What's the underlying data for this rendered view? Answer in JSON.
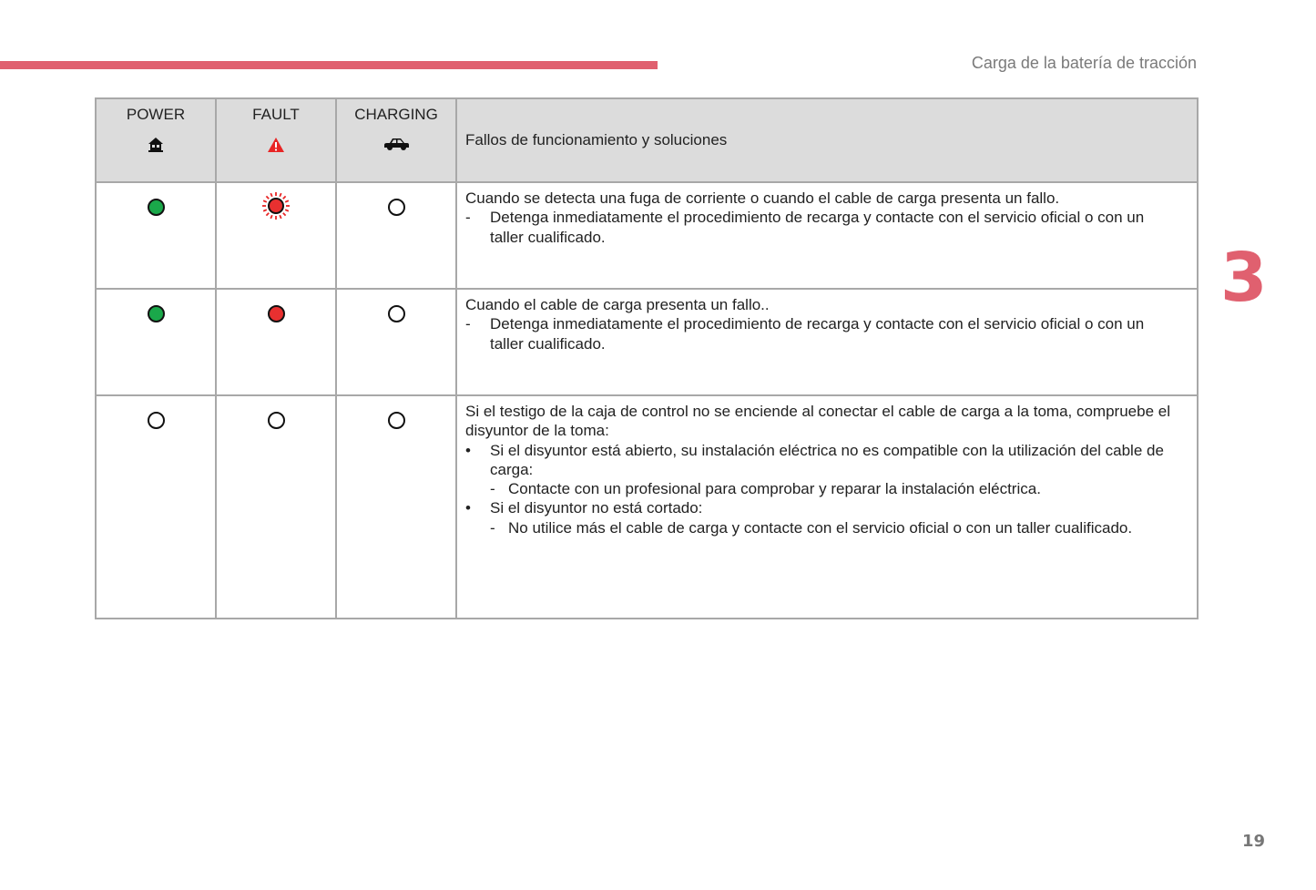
{
  "header": {
    "section_title": "Carga de la batería de tracción",
    "chapter": "3",
    "accent_color": "#e0606f"
  },
  "table": {
    "columns": [
      {
        "label": "POWER",
        "icon": "house-icon"
      },
      {
        "label": "FAULT",
        "icon": "warning-triangle-icon"
      },
      {
        "label": "CHARGING",
        "icon": "car-icon"
      }
    ],
    "description_header": "Fallos de funcionamiento y soluciones",
    "rows": [
      {
        "power": "green-on",
        "fault": "red-blinking",
        "charging": "off",
        "intro": "Cuando se detecta una fuga de corriente o cuando el cable de carga presenta un fallo.",
        "items": [
          {
            "marker": "-",
            "text": "Detenga inmediatamente el procedimiento de recarga y contacte con el servicio oficial o con un taller cualificado."
          }
        ]
      },
      {
        "power": "green-on",
        "fault": "red-on",
        "charging": "off",
        "intro": "Cuando el cable de carga presenta un fallo..",
        "items": [
          {
            "marker": "-",
            "text": "Detenga inmediatamente el procedimiento de recarga y contacte con el servicio oficial o con un taller cualificado."
          }
        ]
      },
      {
        "power": "off",
        "fault": "off",
        "charging": "off",
        "intro": "Si el testigo de la caja de control no se enciende al conectar el cable de carga a la toma, compruebe el disyuntor de la toma:",
        "items": [
          {
            "marker": "•",
            "text": "Si el disyuntor está abierto, su instalación eléctrica no es compatible con la utilización del cable de carga:"
          },
          {
            "marker": "-",
            "text": "Contacte con un profesional para comprobar y reparar la instalación eléctrica."
          },
          {
            "marker": "•",
            "text": "Si el disyuntor no está cortado:"
          },
          {
            "marker": "-",
            "text": "No utilice más el cable de carga y contacte con el servicio oficial o con un taller cualificado."
          }
        ]
      }
    ]
  },
  "footer": {
    "page_number": "19"
  }
}
